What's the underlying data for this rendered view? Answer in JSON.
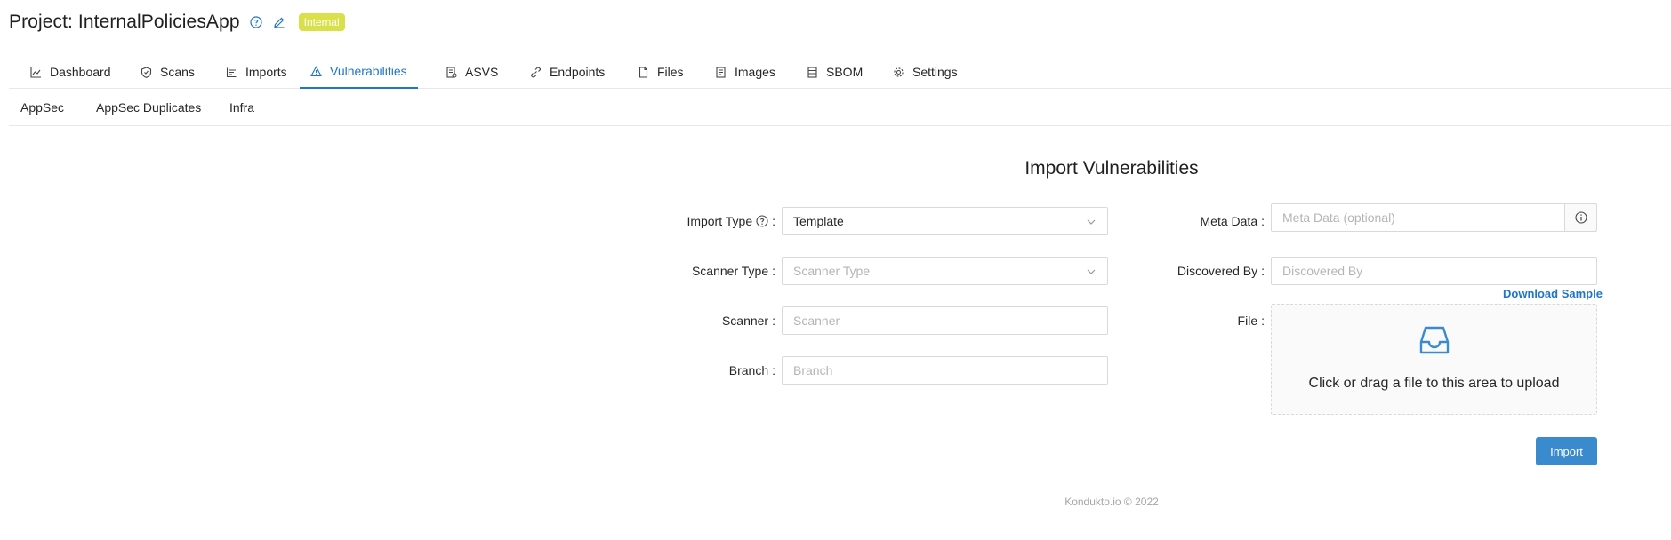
{
  "header": {
    "title": "Project: InternalPoliciesApp",
    "badge": "Internal",
    "help_icon": "question-circle-icon",
    "edit_icon": "pencil-icon",
    "accent": "#1f76c2",
    "badge_color": "#d9e04a"
  },
  "tabs": [
    {
      "label": "Dashboard",
      "icon": "chart-icon"
    },
    {
      "label": "Scans",
      "icon": "shield-icon"
    },
    {
      "label": "Imports",
      "icon": "import-icon"
    },
    {
      "label": "Vulnerabilities",
      "icon": "warning-icon",
      "active": true
    },
    {
      "label": "ASVS",
      "icon": "checklist-icon"
    },
    {
      "label": "Endpoints",
      "icon": "link-icon"
    },
    {
      "label": "Files",
      "icon": "file-icon"
    },
    {
      "label": "Images",
      "icon": "container-icon"
    },
    {
      "label": "SBOM",
      "icon": "list-icon"
    },
    {
      "label": "Settings",
      "icon": "gear-icon"
    }
  ],
  "subtabs": [
    {
      "label": "AppSec"
    },
    {
      "label": "AppSec Duplicates"
    },
    {
      "label": "Infra"
    }
  ],
  "form": {
    "title": "Import Vulnerabilities",
    "import_type": {
      "label": "Import Type",
      "value": "Template"
    },
    "scanner_type": {
      "label": "Scanner Type",
      "placeholder": "Scanner Type"
    },
    "scanner": {
      "label": "Scanner",
      "placeholder": "Scanner"
    },
    "branch": {
      "label": "Branch",
      "placeholder": "Branch"
    },
    "meta_data": {
      "label": "Meta Data",
      "placeholder": "Meta Data (optional)"
    },
    "discovered_by": {
      "label": "Discovered By",
      "placeholder": "Discovered By"
    },
    "download_sample": "Download Sample",
    "file": {
      "label": "File",
      "dropzone_text": "Click or drag a file to this area to upload"
    },
    "import_button": "Import",
    "colon": ":"
  },
  "footer": "Kondukto.io © 2022"
}
